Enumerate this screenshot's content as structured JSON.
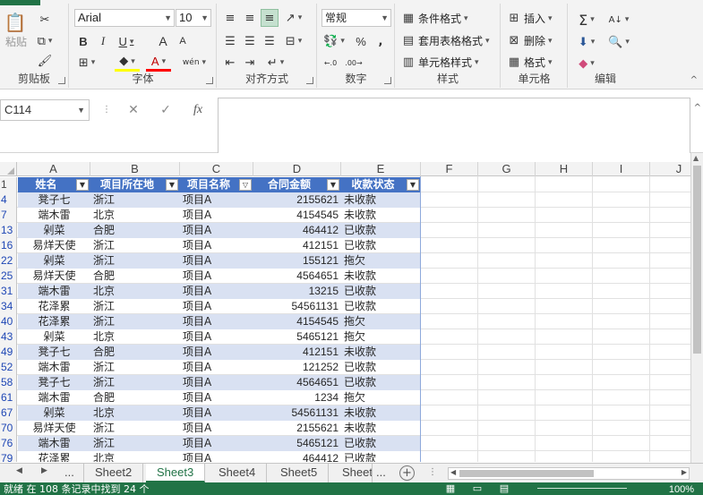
{
  "ribbon": {
    "clipboard": {
      "paste": "粘贴",
      "label": "剪贴板"
    },
    "font": {
      "name": "Arial",
      "size": "10",
      "bold": "B",
      "italic": "I",
      "underline": "U",
      "grow": "A",
      "shrink": "A",
      "phonetic": "wén",
      "label": "字体"
    },
    "alignment": {
      "label": "对齐方式"
    },
    "number": {
      "format": "常规",
      "percent": "%",
      "comma": ",",
      "label": "数字"
    },
    "styles": {
      "conditional": "条件格式",
      "table": "套用表格格式",
      "cell": "单元格样式",
      "label": "样式"
    },
    "cells": {
      "insert": "插入",
      "delete": "删除",
      "format": "格式",
      "label": "单元格"
    },
    "editing": {
      "label": "编辑"
    }
  },
  "formula_bar": {
    "name_box": "C114",
    "formula": ""
  },
  "columns": [
    "A",
    "B",
    "C",
    "D",
    "E",
    "F",
    "G",
    "H",
    "I",
    "J"
  ],
  "header_row": {
    "row": "1",
    "cells": [
      "姓名",
      "项目所在地",
      "项目名称",
      "合同金额",
      "收款状态"
    ]
  },
  "rows": [
    {
      "row": "4",
      "name": "凳子七",
      "place": "浙江",
      "project": "项目A",
      "amount": "2155621",
      "status": "未收款"
    },
    {
      "row": "7",
      "name": "端木雷",
      "place": "北京",
      "project": "项目A",
      "amount": "4154545",
      "status": "未收款"
    },
    {
      "row": "13",
      "name": "剁菜",
      "place": "合肥",
      "project": "项目A",
      "amount": "464412",
      "status": "已收款"
    },
    {
      "row": "16",
      "name": "易烊天使",
      "place": "浙江",
      "project": "项目A",
      "amount": "412151",
      "status": "已收款"
    },
    {
      "row": "22",
      "name": "剁菜",
      "place": "浙江",
      "project": "项目A",
      "amount": "155121",
      "status": "拖欠"
    },
    {
      "row": "25",
      "name": "易烊天使",
      "place": "合肥",
      "project": "项目A",
      "amount": "4564651",
      "status": "未收款"
    },
    {
      "row": "31",
      "name": "端木雷",
      "place": "北京",
      "project": "项目A",
      "amount": "13215",
      "status": "已收款"
    },
    {
      "row": "34",
      "name": "花泽累",
      "place": "浙江",
      "project": "项目A",
      "amount": "54561131",
      "status": "已收款"
    },
    {
      "row": "40",
      "name": "花泽累",
      "place": "浙江",
      "project": "项目A",
      "amount": "4154545",
      "status": "拖欠"
    },
    {
      "row": "43",
      "name": "剁菜",
      "place": "北京",
      "project": "项目A",
      "amount": "5465121",
      "status": "拖欠"
    },
    {
      "row": "49",
      "name": "凳子七",
      "place": "合肥",
      "project": "项目A",
      "amount": "412151",
      "status": "未收款"
    },
    {
      "row": "52",
      "name": "端木雷",
      "place": "浙江",
      "project": "项目A",
      "amount": "121252",
      "status": "已收款"
    },
    {
      "row": "58",
      "name": "凳子七",
      "place": "浙江",
      "project": "项目A",
      "amount": "4564651",
      "status": "已收款"
    },
    {
      "row": "61",
      "name": "端木雷",
      "place": "合肥",
      "project": "项目A",
      "amount": "1234",
      "status": "拖欠"
    },
    {
      "row": "67",
      "name": "剁菜",
      "place": "北京",
      "project": "项目A",
      "amount": "54561131",
      "status": "未收款"
    },
    {
      "row": "70",
      "name": "易烊天使",
      "place": "浙江",
      "project": "项目A",
      "amount": "2155621",
      "status": "未收款"
    },
    {
      "row": "76",
      "name": "端木雷",
      "place": "浙江",
      "project": "项目A",
      "amount": "5465121",
      "status": "已收款"
    },
    {
      "row": "79",
      "name": "花泽累",
      "place": "北京",
      "project": "项目A",
      "amount": "464412",
      "status": "已收款"
    }
  ],
  "sheets": {
    "more": "...",
    "tabs": [
      "Sheet2",
      "Sheet3",
      "Sheet4",
      "Sheet5",
      "Sheet"
    ],
    "active": "Sheet3",
    "overflow": "..."
  },
  "status": {
    "text": "就绪    在 108 条记录中找到 24 个",
    "zoom": "100%"
  },
  "colors": {
    "accent": "#217346",
    "table_header": "#4472c4",
    "band": "#d9e1f2"
  }
}
